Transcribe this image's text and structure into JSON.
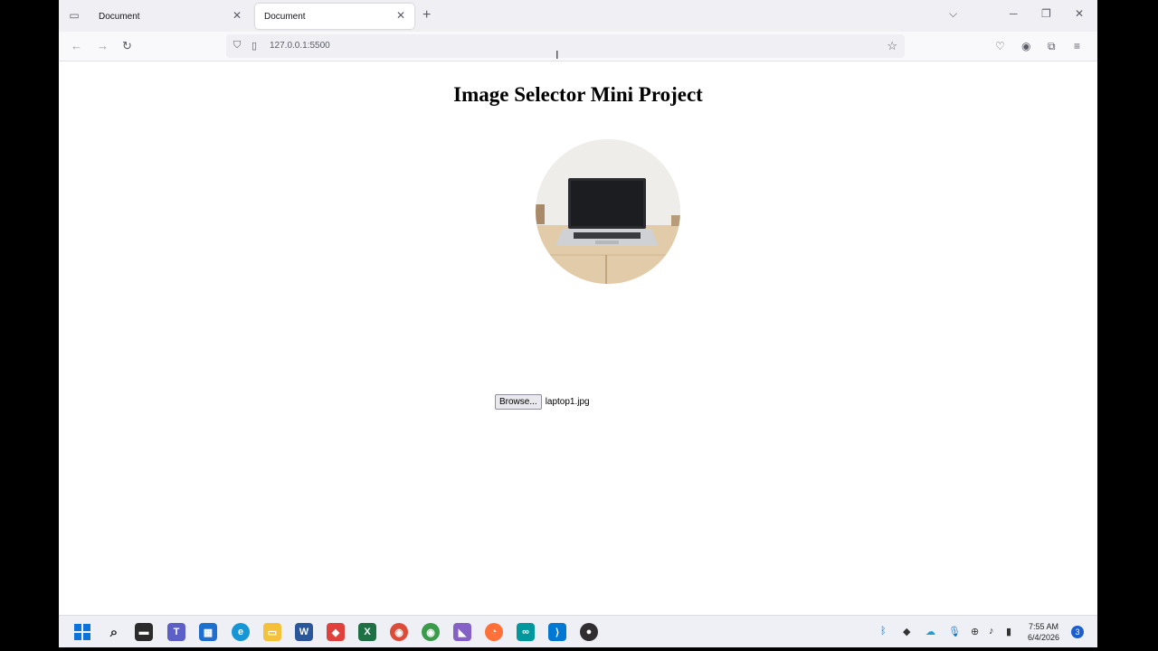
{
  "browser": {
    "tabs": [
      {
        "title": "Document",
        "active": false
      },
      {
        "title": "Document",
        "active": true
      }
    ],
    "url": "127.0.0.1:5500"
  },
  "page": {
    "heading": "Image Selector Mini Project",
    "file_input": {
      "button_label": "Browse...",
      "selected_file": "laptop1.jpg"
    },
    "preview_image_alt": "laptop"
  },
  "taskbar": {
    "icons": [
      "windows-start",
      "search",
      "file-explorer-dark",
      "teams",
      "store",
      "edge",
      "file-explorer",
      "word",
      "git",
      "excel",
      "chrome",
      "chrome-canary",
      "visual-studio",
      "firefox",
      "arduino",
      "vscode",
      "obs"
    ],
    "clock_time": "7:55 AM",
    "clock_date": "6/4/2026",
    "notification_count": "3"
  },
  "colors": {
    "accent": "#0078d4",
    "tab_bar": "#f0f0f4"
  }
}
